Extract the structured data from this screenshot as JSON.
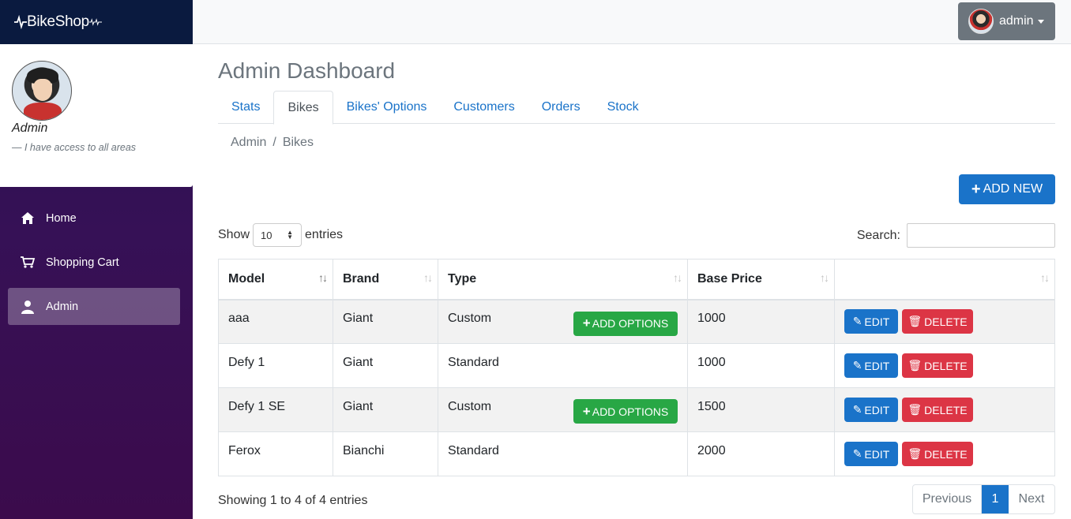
{
  "brand": {
    "name": "BikeShop"
  },
  "profile": {
    "name": "Admin",
    "quote": "— I have access to all areas"
  },
  "nav": [
    {
      "label": "Home",
      "icon": "home-icon"
    },
    {
      "label": "Shopping Cart",
      "icon": "cart-icon"
    },
    {
      "label": "Admin",
      "icon": "user-icon",
      "active": true
    }
  ],
  "user_menu": {
    "label": "admin"
  },
  "page": {
    "title": "Admin Dashboard",
    "tabs": [
      "Stats",
      "Bikes",
      "Bikes' Options",
      "Customers",
      "Orders",
      "Stock"
    ],
    "active_tab": "Bikes",
    "breadcrumb": [
      "Admin",
      "Bikes"
    ],
    "add_new_label": "ADD NEW"
  },
  "table": {
    "show_label": "Show",
    "entries_value": "10",
    "entries_label": "entries",
    "search_label": "Search:",
    "search_value": "",
    "columns": [
      "Model",
      "Brand",
      "Type",
      "Base Price",
      ""
    ],
    "rows": [
      {
        "model": "aaa",
        "brand": "Giant",
        "type": "Custom",
        "base_price": "1000",
        "has_options": true
      },
      {
        "model": "Defy 1",
        "brand": "Giant",
        "type": "Standard",
        "base_price": "1000",
        "has_options": false
      },
      {
        "model": "Defy 1 SE",
        "brand": "Giant",
        "type": "Custom",
        "base_price": "1500",
        "has_options": true
      },
      {
        "model": "Ferox",
        "brand": "Bianchi",
        "type": "Standard",
        "base_price": "2000",
        "has_options": false
      }
    ],
    "add_options_label": "ADD OPTIONS",
    "edit_label": "EDIT",
    "delete_label": "DELETE",
    "info": "Showing 1 to 4 of 4 entries",
    "pagination": {
      "previous": "Previous",
      "current": "1",
      "next": "Next"
    }
  },
  "colors": {
    "primary": "#1a73c9",
    "success": "#28a745",
    "danger": "#dc3545",
    "sidebar_top": "#27124f",
    "sidebar_bottom": "#3b0b4c"
  }
}
